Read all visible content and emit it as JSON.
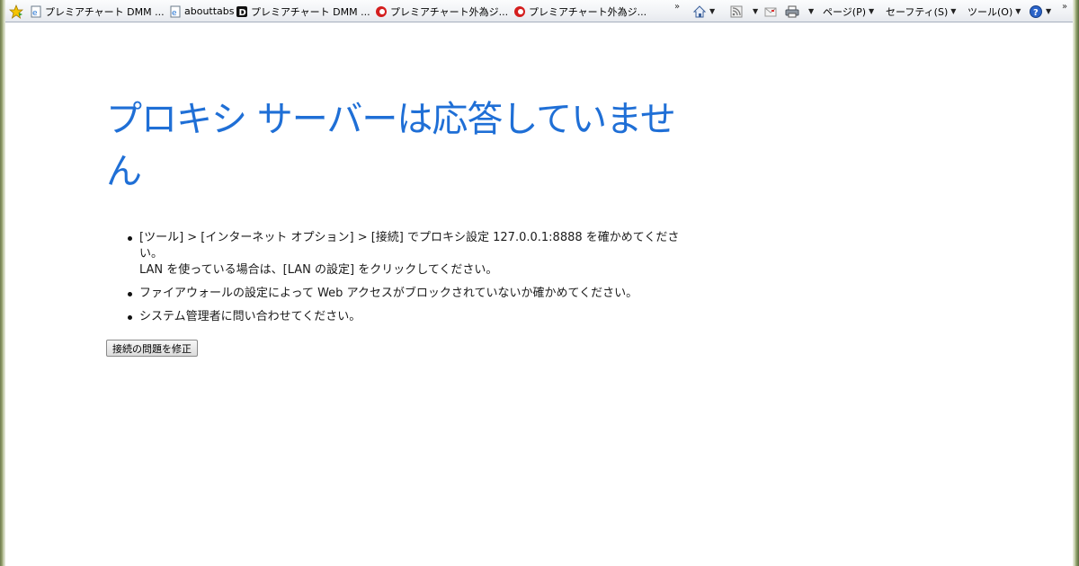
{
  "toolbar": {
    "favorites": [
      {
        "label": "プレミアチャート DMM ...",
        "icon": "ie-page-icon"
      },
      {
        "label": "abouttabs",
        "icon": "ie-page-icon"
      },
      {
        "label": "プレミアチャート DMM ...",
        "icon": "dmm-d-icon"
      },
      {
        "label": "プレミアチャート外為ジ...",
        "icon": "gaitame-icon"
      },
      {
        "label": "プレミアチャート外為ジ...",
        "icon": "gaitame-icon"
      }
    ],
    "overflow_chevron": "»",
    "right_chevron": "»",
    "commands": {
      "page": "ページ(P)",
      "safety": "セーフティ(S)",
      "tools": "ツール(O)"
    }
  },
  "main": {
    "title": "プロキシ サーバーは応答していません",
    "tips": [
      {
        "line1": "[ツール] > [インターネット オプション] > [接続] でプロキシ設定 127.0.0.1:8888 を確かめてください。",
        "line2": "LAN を使っている場合は、[LAN の設定] をクリックしてください。"
      },
      {
        "line1": "ファイアウォールの設定によって Web アクセスがブロックされていないか確かめてください。",
        "line2": ""
      },
      {
        "line1": "システム管理者に問い合わせてください。",
        "line2": ""
      }
    ],
    "fix_button": "接続の問題を修正"
  },
  "colors": {
    "title": "#1f6fd6",
    "toolbar_bg": "#eef0f4"
  }
}
